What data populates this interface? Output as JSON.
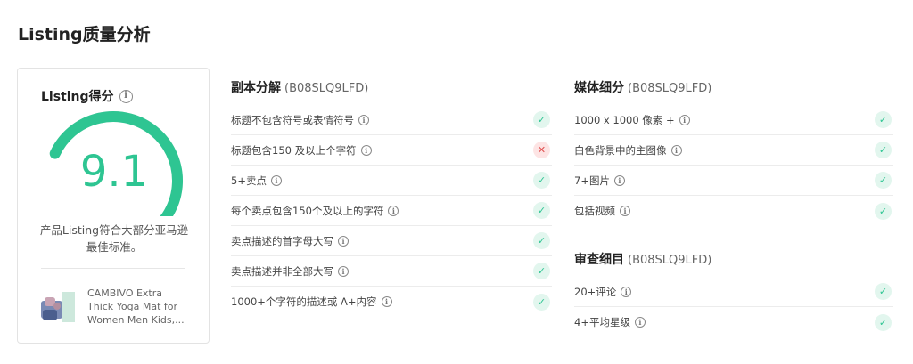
{
  "page_title": "Listing质量分析",
  "score_card": {
    "label": "Listing得分",
    "score": "9.1",
    "score_fraction": 0.91,
    "description": "产品Listing符合大部分亚马逊最佳标准。",
    "product_name": "CAMBIVO Extra Thick Yoga Mat for Women Men Kids,...",
    "accent_color": "#2ec592",
    "track_color": "#e6e6e6"
  },
  "copy_section": {
    "title": "副本分解",
    "sku": "(B08SLQ9LFD)",
    "items": [
      {
        "label": "标题不包含符号或表情符号",
        "status": "pass"
      },
      {
        "label": "标题包含150 及以上个字符",
        "status": "fail"
      },
      {
        "label": "5+卖点",
        "status": "pass"
      },
      {
        "label": "每个卖点包含150个及以上的字符",
        "status": "pass"
      },
      {
        "label": "卖点描述的首字母大写",
        "status": "pass"
      },
      {
        "label": "卖点描述并非全部大写",
        "status": "pass"
      },
      {
        "label": "1000+个字符的描述或 A+内容",
        "status": "pass"
      }
    ]
  },
  "media_section": {
    "title": "媒体细分",
    "sku": "(B08SLQ9LFD)",
    "items": [
      {
        "label": "1000 x 1000 像素 +",
        "status": "pass"
      },
      {
        "label": "白色背景中的主图像",
        "status": "pass"
      },
      {
        "label": "7+图片",
        "status": "pass"
      },
      {
        "label": "包括视频",
        "status": "pass"
      }
    ]
  },
  "review_section": {
    "title": "审查细目",
    "sku": "(B08SLQ9LFD)",
    "items": [
      {
        "label": "20+评论",
        "status": "pass"
      },
      {
        "label": "4+平均星级",
        "status": "pass"
      }
    ]
  },
  "icons": {
    "info": "info-icon",
    "pass": "check-icon",
    "fail": "cross-icon"
  }
}
